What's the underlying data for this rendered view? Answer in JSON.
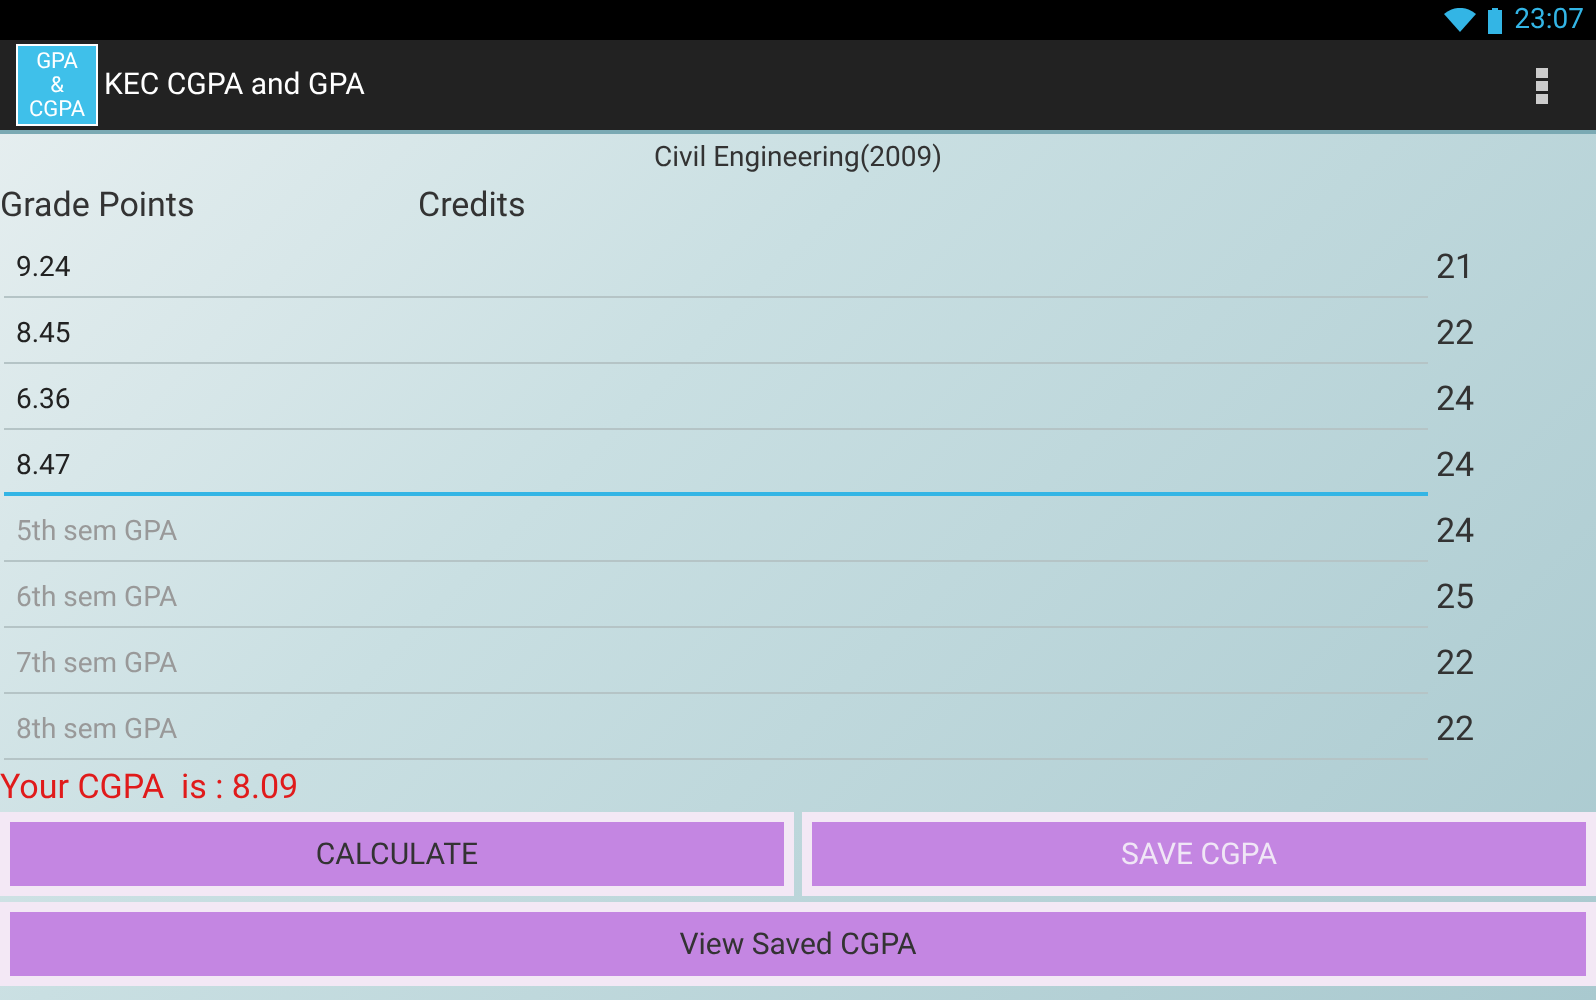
{
  "status_bar": {
    "time": "23:07"
  },
  "action_bar": {
    "logo_lines": [
      "GPA",
      "&",
      "CGPA"
    ],
    "title": "KEC CGPA and GPA"
  },
  "department": "Civil Engineering(2009)",
  "headers": [
    "Grade Points",
    "Credits"
  ],
  "rows": [
    {
      "value": "9.24",
      "credits": "21",
      "focused": false
    },
    {
      "value": "8.45",
      "credits": "22",
      "focused": false
    },
    {
      "value": "6.36",
      "credits": "24",
      "focused": false
    },
    {
      "value": "8.47",
      "credits": "24",
      "focused": true
    },
    {
      "placeholder": "5th sem GPA",
      "credits": "24",
      "focused": false
    },
    {
      "placeholder": "6th sem GPA",
      "credits": "25",
      "focused": false
    },
    {
      "placeholder": "7th sem GPA",
      "credits": "22",
      "focused": false
    },
    {
      "placeholder": "8th sem GPA",
      "credits": "22",
      "focused": false
    }
  ],
  "result": "Your CGPA  is : 8.09",
  "buttons": [
    {
      "label": "CALCULATE",
      "disabled": false
    },
    {
      "label": "SAVE CGPA",
      "disabled": true
    }
  ],
  "wide_button": {
    "label": "View Saved CGPA",
    "disabled": false
  }
}
